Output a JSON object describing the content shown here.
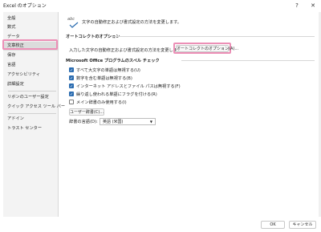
{
  "window": {
    "title": "Excel のオプション",
    "help": "?",
    "close": "✕"
  },
  "sidebar": {
    "items": [
      {
        "label": "全般"
      },
      {
        "label": "数式"
      },
      {
        "label": "データ"
      },
      {
        "label": "文章校正"
      },
      {
        "label": "保存"
      },
      {
        "label": "言語"
      },
      {
        "label": "アクセシビリティ"
      },
      {
        "label": "詳細設定"
      },
      {
        "label": "リボンのユーザー設定"
      },
      {
        "label": "クイック アクセス ツール バー"
      },
      {
        "label": "アドイン"
      },
      {
        "label": "トラスト センター"
      }
    ]
  },
  "main": {
    "header_icon_text": "abc",
    "header_text": "文字の自動修正および書式設定の方法を変更します。",
    "autocorrect_section": {
      "title": "オートコレクトのオプション",
      "description": "入力した文字の自動修正および書式設定の方法を変更します:",
      "button": "オートコレクトのオプション(A)..."
    },
    "spell_section": {
      "title": "Microsoft Office プログラムのスペル チェック",
      "checkboxes": [
        {
          "label": "すべて大文字の単語は無視する(U)",
          "checked": true
        },
        {
          "label": "数字を含む単語は無視する(B)",
          "checked": true
        },
        {
          "label": "インターネット アドレスとファイル パスは無視する(F)",
          "checked": true
        },
        {
          "label": "繰り返し使われる単語にフラグを付ける(R)",
          "checked": true
        },
        {
          "label": "メイン辞書のみ使用する(I)",
          "checked": false
        }
      ],
      "user_dictionary_button": "ユーザー辞書(C)...",
      "dictionary_language_label": "辞書の言語(D):",
      "dictionary_language_value": "英語 (米国)"
    }
  },
  "footer": {
    "ok": "OK",
    "cancel": "キャンセル"
  }
}
